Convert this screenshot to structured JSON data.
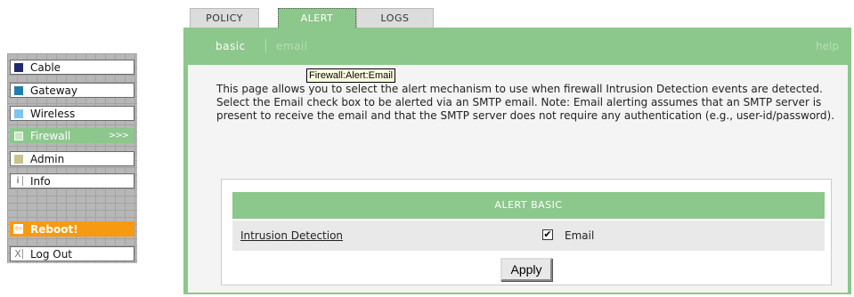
{
  "nav": {
    "items": [
      {
        "label": "Cable",
        "color": "#1f2a6b"
      },
      {
        "label": "Gateway",
        "color": "#1f7cae"
      },
      {
        "label": "Wireless",
        "color": "#7ec4f0"
      },
      {
        "label": "Firewall",
        "color": "#8cc78b",
        "arrow": ">>>"
      },
      {
        "label": "Admin",
        "color": "#c8c48c"
      },
      {
        "label": "Info",
        "icon": "i"
      }
    ],
    "reboot": {
      "label": "Reboot!",
      "color": "#f79a12"
    },
    "logout": {
      "label": "Log Out",
      "icon": "X"
    }
  },
  "tabs": [
    "POLICY",
    "ALERT",
    "LOGS"
  ],
  "subnav": {
    "basic": "basic",
    "email": "email",
    "help": "help"
  },
  "tooltip": "Firewall:Alert:Email",
  "description": "This page allows you to select the alert mechanism to use when firewall Intrusion Detection events are detected. Select the Email check box to be alerted via an SMTP email. Note: Email alerting assumes that an SMTP server is present to receive the email and that the SMTP server does not require any authentication (e.g., user-id/password).",
  "table": {
    "header": "ALERT BASIC",
    "row_label": "Intrusion Detection",
    "checkbox_mark": "✔",
    "checkbox_label": "Email"
  },
  "apply_label": "Apply",
  "colors": {
    "accent": "#8cc78b",
    "reboot": "#f79a12"
  }
}
